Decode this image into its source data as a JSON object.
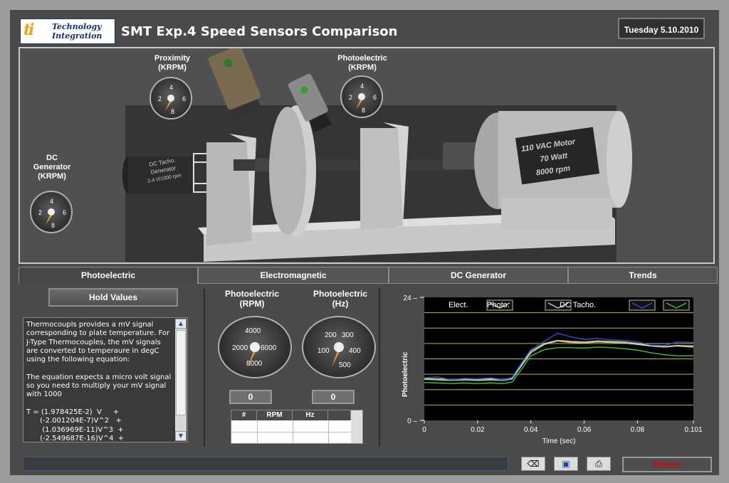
{
  "header": {
    "logo_mark": "ti",
    "logo_line1": "Technology",
    "logo_line2": "Integration",
    "title": "SMT Exp.4 Speed Sensors Comparison",
    "date": "Tuesday 5.10.2010"
  },
  "scene": {
    "gauge_proximity": {
      "label1": "Proximity",
      "label2": "(KRPM)",
      "ticks": [
        "2",
        "4",
        "6",
        "8"
      ]
    },
    "gauge_photo_top": {
      "label1": "Photoelectric",
      "label2": "(KRPM)",
      "ticks": [
        "2",
        "4",
        "6",
        "8"
      ]
    },
    "gauge_dc": {
      "label1": "DC",
      "label2": "Generator",
      "label3": "(KRPM)",
      "ticks": [
        "2",
        "4",
        "6",
        "8"
      ]
    },
    "tacho_text": [
      "DC Tacho.",
      "Generator",
      "2.4 V/1000 rpm"
    ],
    "motor_text": [
      "110 VAC Motor",
      "70 Watt",
      "8000 rpm"
    ]
  },
  "tabs": [
    {
      "label": "Photoelectric",
      "active": true
    },
    {
      "label": "Electromagnetic",
      "active": false
    },
    {
      "label": "DC Generator",
      "active": false
    },
    {
      "label": "Trends",
      "active": false
    }
  ],
  "panel": {
    "hold_button": "Hold Values",
    "description": "Thermocoupls provides a mV signal corresponding to plate temperature. For J-Type Thermocouples, the mV signals are converted to temperaure in degC using the following equation:\n\nThe equation expects a micro volt signal so you need to multiply your mV signal with 1000\n\nT = (1.978425E-2)  V     +\n      (-2.001204E-7)V^2   +\n       (1.036969E-11)V^3  +\n      (-2.549687E-16)V^4  +",
    "rpm_gauge": {
      "label1": "Photoelectric",
      "label2": "(RPM)",
      "ticks": [
        "2000",
        "4000",
        "6000",
        "8000"
      ],
      "value": "0"
    },
    "hz_gauge": {
      "label1": "Photoelectric",
      "label2": "(Hz)",
      "ticks": [
        "100",
        "200",
        "300",
        "400",
        "500"
      ],
      "value": "0"
    },
    "table_headers": [
      "#",
      "RPM",
      "Hz",
      ""
    ]
  },
  "colors": {
    "elect": "#d8d870",
    "photo": "#c8c8c8",
    "dc_tacho": "#3050e0",
    "green": "#40c040",
    "grid": "#b8b840"
  },
  "chart_data": {
    "type": "line",
    "ylabel": "Photoelectric",
    "xlabel": "Time (sec)",
    "xlim": [
      0,
      0.101
    ],
    "ylim": [
      0,
      24
    ],
    "x_ticks": [
      "0",
      "0.02",
      "0.04",
      "0.06",
      "0.08",
      "0.101"
    ],
    "y_ticks": [
      "0",
      "24"
    ],
    "legend_position": "top",
    "x": [
      0,
      0.005,
      0.01,
      0.015,
      0.02,
      0.025,
      0.03,
      0.033,
      0.036,
      0.04,
      0.045,
      0.05,
      0.055,
      0.06,
      0.065,
      0.07,
      0.075,
      0.08,
      0.085,
      0.09,
      0.095,
      0.101
    ],
    "series": [
      {
        "name": "Elect.",
        "values": [
          8.2,
          8.1,
          8.0,
          8.1,
          8.0,
          8.1,
          8.0,
          8.3,
          10.5,
          13.5,
          15.0,
          15.6,
          15.4,
          15.3,
          15.5,
          15.4,
          15.3,
          15.0,
          14.6,
          14.4,
          14.6,
          14.5
        ]
      },
      {
        "name": "Photo.",
        "values": [
          8.0,
          7.9,
          7.8,
          7.9,
          7.8,
          7.9,
          7.8,
          8.1,
          10.3,
          13.2,
          14.8,
          15.5,
          15.2,
          15.1,
          15.3,
          15.2,
          15.1,
          14.8,
          14.5,
          14.3,
          14.5,
          14.3
        ]
      },
      {
        "name": "DC Tacho.",
        "values": [
          8.3,
          8.5,
          7.9,
          8.2,
          8.1,
          8.3,
          7.9,
          8.4,
          10.8,
          13.8,
          15.4,
          17.0,
          16.3,
          15.8,
          16.0,
          15.7,
          15.6,
          15.3,
          14.7,
          14.6,
          15.3,
          15.2
        ]
      },
      {
        "name": "",
        "values": [
          7.4,
          7.3,
          7.2,
          7.3,
          7.2,
          7.3,
          7.2,
          7.5,
          9.6,
          12.6,
          13.8,
          14.2,
          14.2,
          14.1,
          14.3,
          14.2,
          14.0,
          13.7,
          13.2,
          12.8,
          12.6,
          12.6
        ]
      }
    ]
  },
  "footer": {
    "return_label": "Return"
  }
}
